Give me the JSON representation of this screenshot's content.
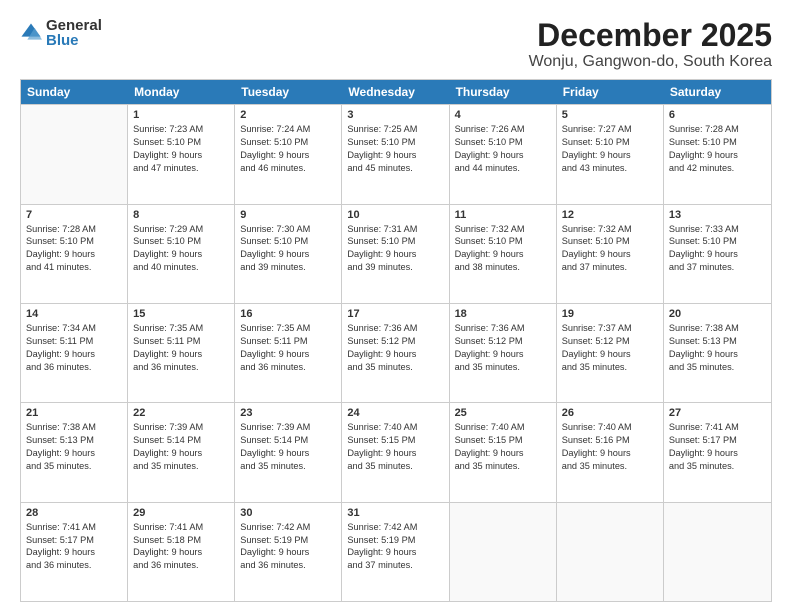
{
  "logo": {
    "general": "General",
    "blue": "Blue"
  },
  "title": "December 2025",
  "subtitle": "Wonju, Gangwon-do, South Korea",
  "header_days": [
    "Sunday",
    "Monday",
    "Tuesday",
    "Wednesday",
    "Thursday",
    "Friday",
    "Saturday"
  ],
  "weeks": [
    [
      {
        "day": "",
        "info": ""
      },
      {
        "day": "1",
        "info": "Sunrise: 7:23 AM\nSunset: 5:10 PM\nDaylight: 9 hours\nand 47 minutes."
      },
      {
        "day": "2",
        "info": "Sunrise: 7:24 AM\nSunset: 5:10 PM\nDaylight: 9 hours\nand 46 minutes."
      },
      {
        "day": "3",
        "info": "Sunrise: 7:25 AM\nSunset: 5:10 PM\nDaylight: 9 hours\nand 45 minutes."
      },
      {
        "day": "4",
        "info": "Sunrise: 7:26 AM\nSunset: 5:10 PM\nDaylight: 9 hours\nand 44 minutes."
      },
      {
        "day": "5",
        "info": "Sunrise: 7:27 AM\nSunset: 5:10 PM\nDaylight: 9 hours\nand 43 minutes."
      },
      {
        "day": "6",
        "info": "Sunrise: 7:28 AM\nSunset: 5:10 PM\nDaylight: 9 hours\nand 42 minutes."
      }
    ],
    [
      {
        "day": "7",
        "info": "Sunrise: 7:28 AM\nSunset: 5:10 PM\nDaylight: 9 hours\nand 41 minutes."
      },
      {
        "day": "8",
        "info": "Sunrise: 7:29 AM\nSunset: 5:10 PM\nDaylight: 9 hours\nand 40 minutes."
      },
      {
        "day": "9",
        "info": "Sunrise: 7:30 AM\nSunset: 5:10 PM\nDaylight: 9 hours\nand 39 minutes."
      },
      {
        "day": "10",
        "info": "Sunrise: 7:31 AM\nSunset: 5:10 PM\nDaylight: 9 hours\nand 39 minutes."
      },
      {
        "day": "11",
        "info": "Sunrise: 7:32 AM\nSunset: 5:10 PM\nDaylight: 9 hours\nand 38 minutes."
      },
      {
        "day": "12",
        "info": "Sunrise: 7:32 AM\nSunset: 5:10 PM\nDaylight: 9 hours\nand 37 minutes."
      },
      {
        "day": "13",
        "info": "Sunrise: 7:33 AM\nSunset: 5:10 PM\nDaylight: 9 hours\nand 37 minutes."
      }
    ],
    [
      {
        "day": "14",
        "info": "Sunrise: 7:34 AM\nSunset: 5:11 PM\nDaylight: 9 hours\nand 36 minutes."
      },
      {
        "day": "15",
        "info": "Sunrise: 7:35 AM\nSunset: 5:11 PM\nDaylight: 9 hours\nand 36 minutes."
      },
      {
        "day": "16",
        "info": "Sunrise: 7:35 AM\nSunset: 5:11 PM\nDaylight: 9 hours\nand 36 minutes."
      },
      {
        "day": "17",
        "info": "Sunrise: 7:36 AM\nSunset: 5:12 PM\nDaylight: 9 hours\nand 35 minutes."
      },
      {
        "day": "18",
        "info": "Sunrise: 7:36 AM\nSunset: 5:12 PM\nDaylight: 9 hours\nand 35 minutes."
      },
      {
        "day": "19",
        "info": "Sunrise: 7:37 AM\nSunset: 5:12 PM\nDaylight: 9 hours\nand 35 minutes."
      },
      {
        "day": "20",
        "info": "Sunrise: 7:38 AM\nSunset: 5:13 PM\nDaylight: 9 hours\nand 35 minutes."
      }
    ],
    [
      {
        "day": "21",
        "info": "Sunrise: 7:38 AM\nSunset: 5:13 PM\nDaylight: 9 hours\nand 35 minutes."
      },
      {
        "day": "22",
        "info": "Sunrise: 7:39 AM\nSunset: 5:14 PM\nDaylight: 9 hours\nand 35 minutes."
      },
      {
        "day": "23",
        "info": "Sunrise: 7:39 AM\nSunset: 5:14 PM\nDaylight: 9 hours\nand 35 minutes."
      },
      {
        "day": "24",
        "info": "Sunrise: 7:40 AM\nSunset: 5:15 PM\nDaylight: 9 hours\nand 35 minutes."
      },
      {
        "day": "25",
        "info": "Sunrise: 7:40 AM\nSunset: 5:15 PM\nDaylight: 9 hours\nand 35 minutes."
      },
      {
        "day": "26",
        "info": "Sunrise: 7:40 AM\nSunset: 5:16 PM\nDaylight: 9 hours\nand 35 minutes."
      },
      {
        "day": "27",
        "info": "Sunrise: 7:41 AM\nSunset: 5:17 PM\nDaylight: 9 hours\nand 35 minutes."
      }
    ],
    [
      {
        "day": "28",
        "info": "Sunrise: 7:41 AM\nSunset: 5:17 PM\nDaylight: 9 hours\nand 36 minutes."
      },
      {
        "day": "29",
        "info": "Sunrise: 7:41 AM\nSunset: 5:18 PM\nDaylight: 9 hours\nand 36 minutes."
      },
      {
        "day": "30",
        "info": "Sunrise: 7:42 AM\nSunset: 5:19 PM\nDaylight: 9 hours\nand 36 minutes."
      },
      {
        "day": "31",
        "info": "Sunrise: 7:42 AM\nSunset: 5:19 PM\nDaylight: 9 hours\nand 37 minutes."
      },
      {
        "day": "",
        "info": ""
      },
      {
        "day": "",
        "info": ""
      },
      {
        "day": "",
        "info": ""
      }
    ]
  ]
}
